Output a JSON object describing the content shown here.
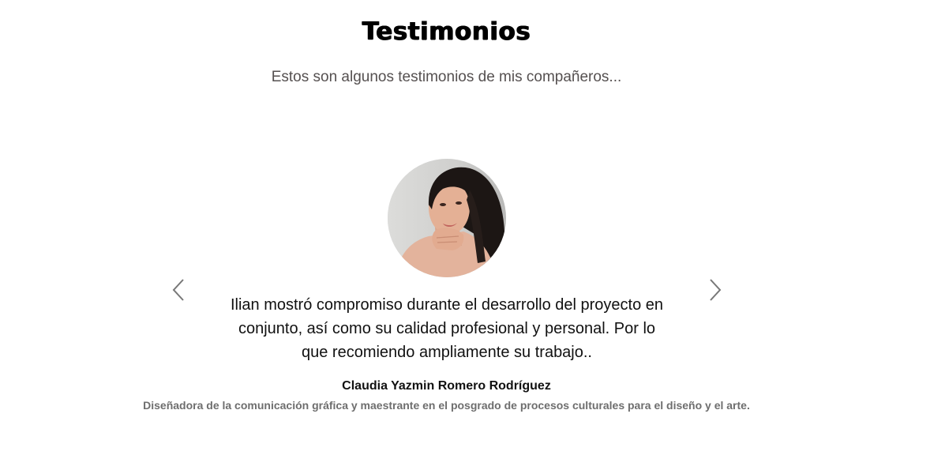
{
  "section": {
    "title": "Testimonios",
    "subtitle": "Estos son algunos testimonios de mis compañeros..."
  },
  "carousel": {
    "prev_icon": "chevron-left-icon",
    "next_icon": "chevron-right-icon",
    "arrow_color": "#777777",
    "testimonial": {
      "avatar_alt": "photo of woman resting chin on hand",
      "quote": "Ilian mostró compromiso durante el desarrollo del proyecto en conjunto, así como su calidad profesional y personal. Por lo que recomiendo ampliamente su trabajo..",
      "author": "Claudia Yazmin Romero Rodríguez",
      "role": "Diseñadora de la comunicación gráfica y maestrante en el posgrado de procesos culturales para el diseño y el arte."
    }
  }
}
